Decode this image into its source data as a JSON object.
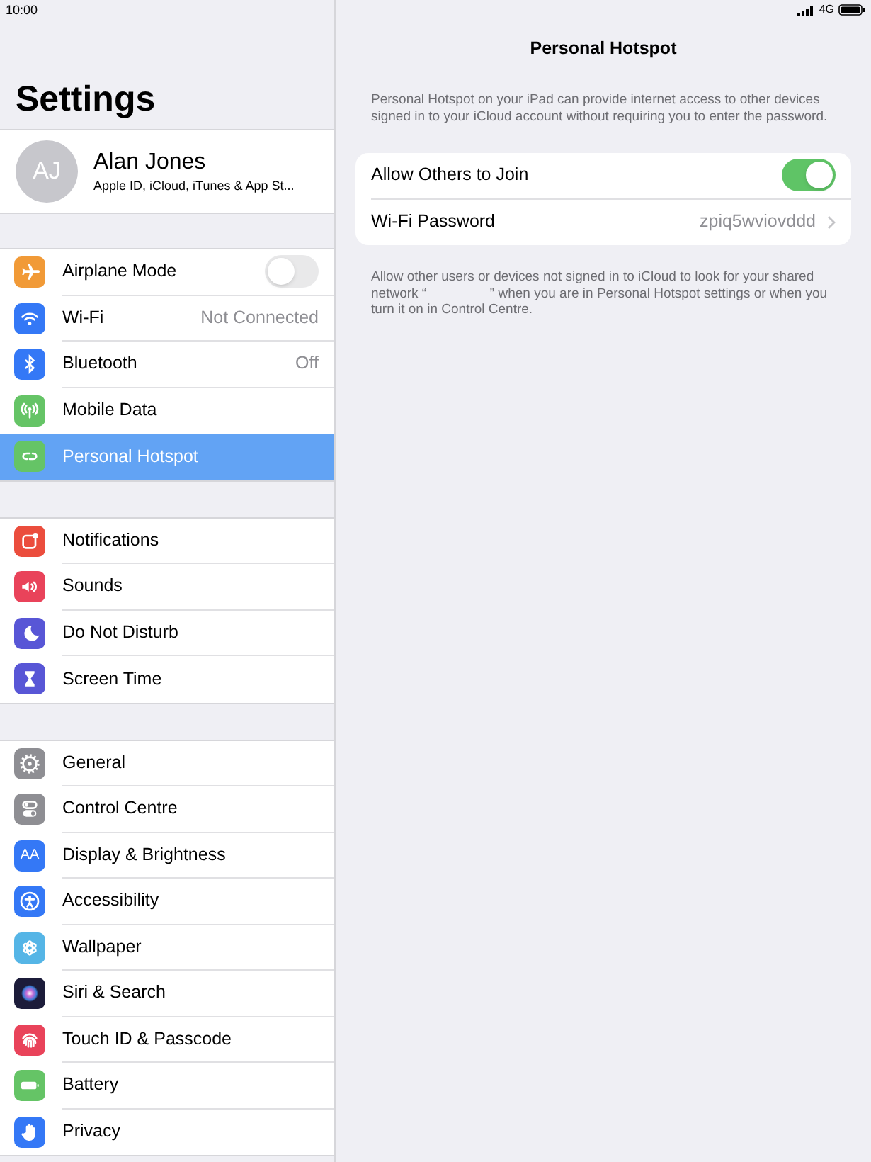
{
  "status_bar": {
    "time": "10:00",
    "network": "4G"
  },
  "sidebar": {
    "title": "Settings",
    "profile": {
      "initials": "AJ",
      "name": "Alan Jones",
      "subtitle": "Apple ID, iCloud, iTunes & App St..."
    },
    "groups": [
      {
        "items": [
          {
            "label": "Airplane Mode",
            "kind": "toggle",
            "on": false,
            "selected": false,
            "color": "#f19a37"
          },
          {
            "label": "Wi-Fi",
            "kind": "value",
            "value": "Not Connected",
            "selected": false,
            "color": "#3478f6"
          },
          {
            "label": "Bluetooth",
            "kind": "value",
            "value": "Off",
            "selected": false,
            "color": "#3478f6"
          },
          {
            "label": "Mobile Data",
            "kind": "link",
            "selected": false,
            "color": "#65c466"
          },
          {
            "label": "Personal Hotspot",
            "kind": "link",
            "selected": true,
            "color": "#65c466"
          }
        ]
      },
      {
        "items": [
          {
            "label": "Notifications",
            "kind": "link",
            "selected": false,
            "color": "#eb4d3d"
          },
          {
            "label": "Sounds",
            "kind": "link",
            "selected": false,
            "color": "#e9435a"
          },
          {
            "label": "Do Not Disturb",
            "kind": "link",
            "selected": false,
            "color": "#5856d6"
          },
          {
            "label": "Screen Time",
            "kind": "link",
            "selected": false,
            "color": "#5856d6"
          }
        ]
      },
      {
        "items": [
          {
            "label": "General",
            "kind": "link",
            "selected": false,
            "color": "#8e8e93"
          },
          {
            "label": "Control Centre",
            "kind": "link",
            "selected": false,
            "color": "#8e8e93"
          },
          {
            "label": "Display & Brightness",
            "kind": "link",
            "selected": false,
            "color": "#3478f6",
            "icon_text": "AA"
          },
          {
            "label": "Accessibility",
            "kind": "link",
            "selected": false,
            "color": "#3478f6"
          },
          {
            "label": "Wallpaper",
            "kind": "link",
            "selected": false,
            "color": "#55b5e6"
          },
          {
            "label": "Siri & Search",
            "kind": "link",
            "selected": false,
            "color": "#1c1c3a"
          },
          {
            "label": "Touch ID & Passcode",
            "kind": "link",
            "selected": false,
            "color": "#e9435a"
          },
          {
            "label": "Battery",
            "kind": "link",
            "selected": false,
            "color": "#65c466"
          },
          {
            "label": "Privacy",
            "kind": "link",
            "selected": false,
            "color": "#3478f6"
          }
        ]
      }
    ]
  },
  "detail": {
    "title": "Personal Hotspot",
    "description": "Personal Hotspot on your iPad can provide internet access to other devices signed in to your iCloud account without requiring you to enter the password.",
    "rows": [
      {
        "label": "Allow Others to Join",
        "kind": "toggle",
        "on": true
      },
      {
        "label": "Wi-Fi Password",
        "kind": "value",
        "value": "zpiq5wviovddd"
      }
    ],
    "footer": "Allow other users or devices not signed in to iCloud to look for your shared network “                 ” when you are in Personal Hotspot settings or when you turn it on in Control Centre."
  }
}
